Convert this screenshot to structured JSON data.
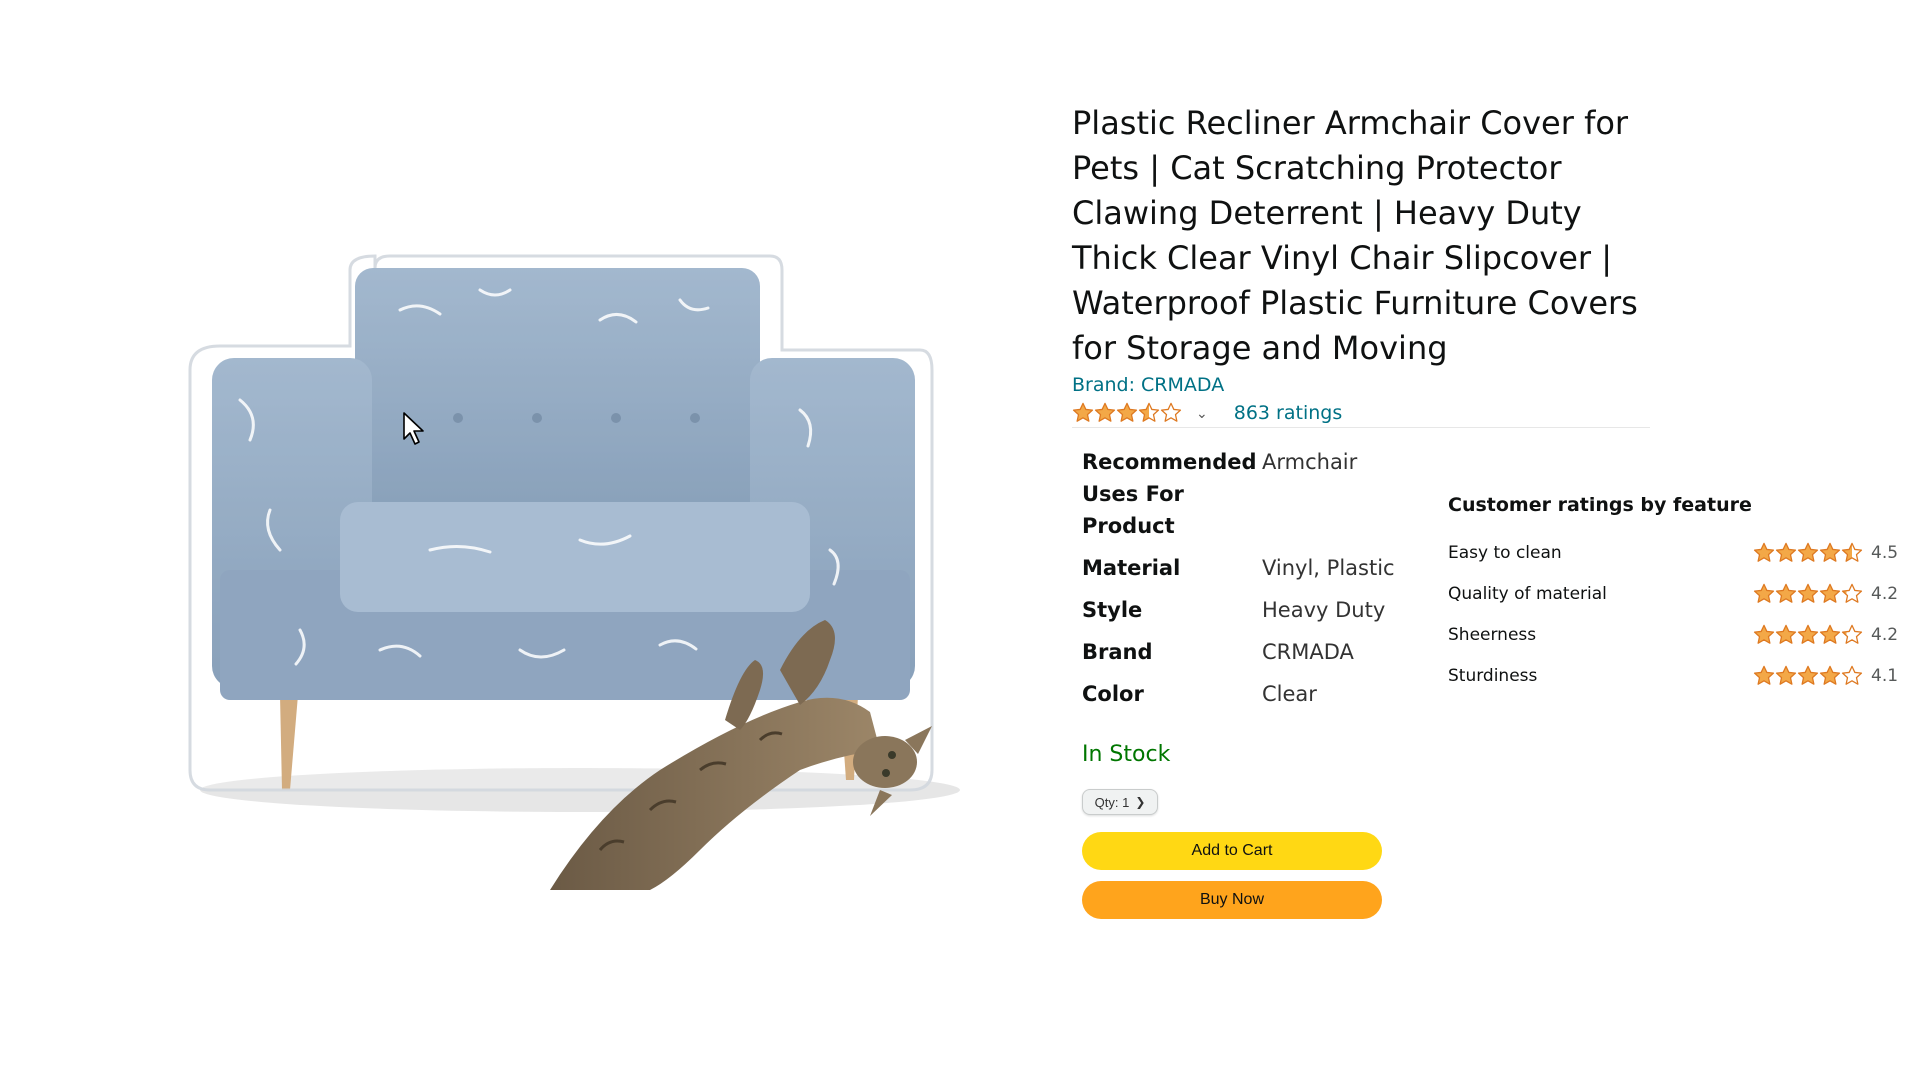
{
  "product": {
    "title": "Plastic Recliner Armchair Cover for Pets | Cat Scratching Protector Clawing Deterrent | Heavy Duty Thick Clear Vinyl Chair Slipcover | Waterproof Plastic Furniture Covers for Storage and Moving",
    "brand": "Brand: CRMADA",
    "rating": 3.5,
    "ratings_count": "863 ratings"
  },
  "specs": [
    {
      "label": "Recommended Uses For Product",
      "value": "Armchair"
    },
    {
      "label": "Material",
      "value": "Vinyl, Plastic"
    },
    {
      "label": "Style",
      "value": "Heavy Duty"
    },
    {
      "label": "Brand",
      "value": "CRMADA"
    },
    {
      "label": "Color",
      "value": "Clear"
    }
  ],
  "purchase": {
    "stock": "In Stock",
    "qty_label": "Qty: 1",
    "add_to_cart": "Add to Cart",
    "buy_now": "Buy Now"
  },
  "feature_ratings": {
    "title": "Customer ratings by feature",
    "items": [
      {
        "name": "Easy to clean",
        "score": "4.5"
      },
      {
        "name": "Quality of material",
        "score": "4.2"
      },
      {
        "name": "Sheerness",
        "score": "4.2"
      },
      {
        "name": "Sturdiness",
        "score": "4.1"
      }
    ]
  },
  "colors": {
    "link": "#007185",
    "star": "#f3a847",
    "in_stock": "#007600",
    "cart_button": "#ffd814",
    "buy_button": "#ffa41c"
  }
}
